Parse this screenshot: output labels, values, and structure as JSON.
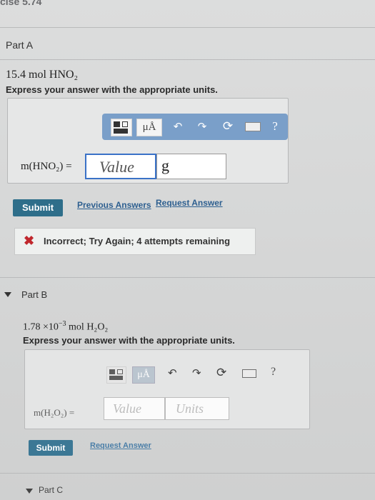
{
  "header": {
    "cut_title": "cise 5.74"
  },
  "partA": {
    "title": "Part A",
    "problem": "15.4 mol HNO₂",
    "instruction": "Express your answer with the appropriate units.",
    "toolbar": {
      "mu_label": "μÅ",
      "help_label": "?"
    },
    "answer_label": "m(HNO₂) =",
    "value": "Value",
    "unit": "g",
    "submit": "Submit",
    "previous_answers": "Previous Answers",
    "request_answer": "Request Answer",
    "feedback": "Incorrect; Try Again; 4 attempts remaining"
  },
  "partB": {
    "title": "Part B",
    "problem_prefix": "1.78 ×10",
    "problem_exp": "−3",
    "problem_suffix": "mol H₂O₂",
    "instruction": "Express your answer with the appropriate units.",
    "toolbar": {
      "mu_label": "μÅ",
      "help_label": "?"
    },
    "answer_label": "m(H₂O₂) =",
    "value_placeholder": "Value",
    "units_placeholder": "Units",
    "submit": "Submit",
    "request_answer": "Request Answer"
  },
  "partC": {
    "title": "Part C"
  },
  "colors": {
    "toolbar": "#7a9fc9",
    "submit": "#2e6e8a",
    "link": "#2d5f90",
    "error": "#c0272d",
    "input_border": "#3a72c7"
  }
}
